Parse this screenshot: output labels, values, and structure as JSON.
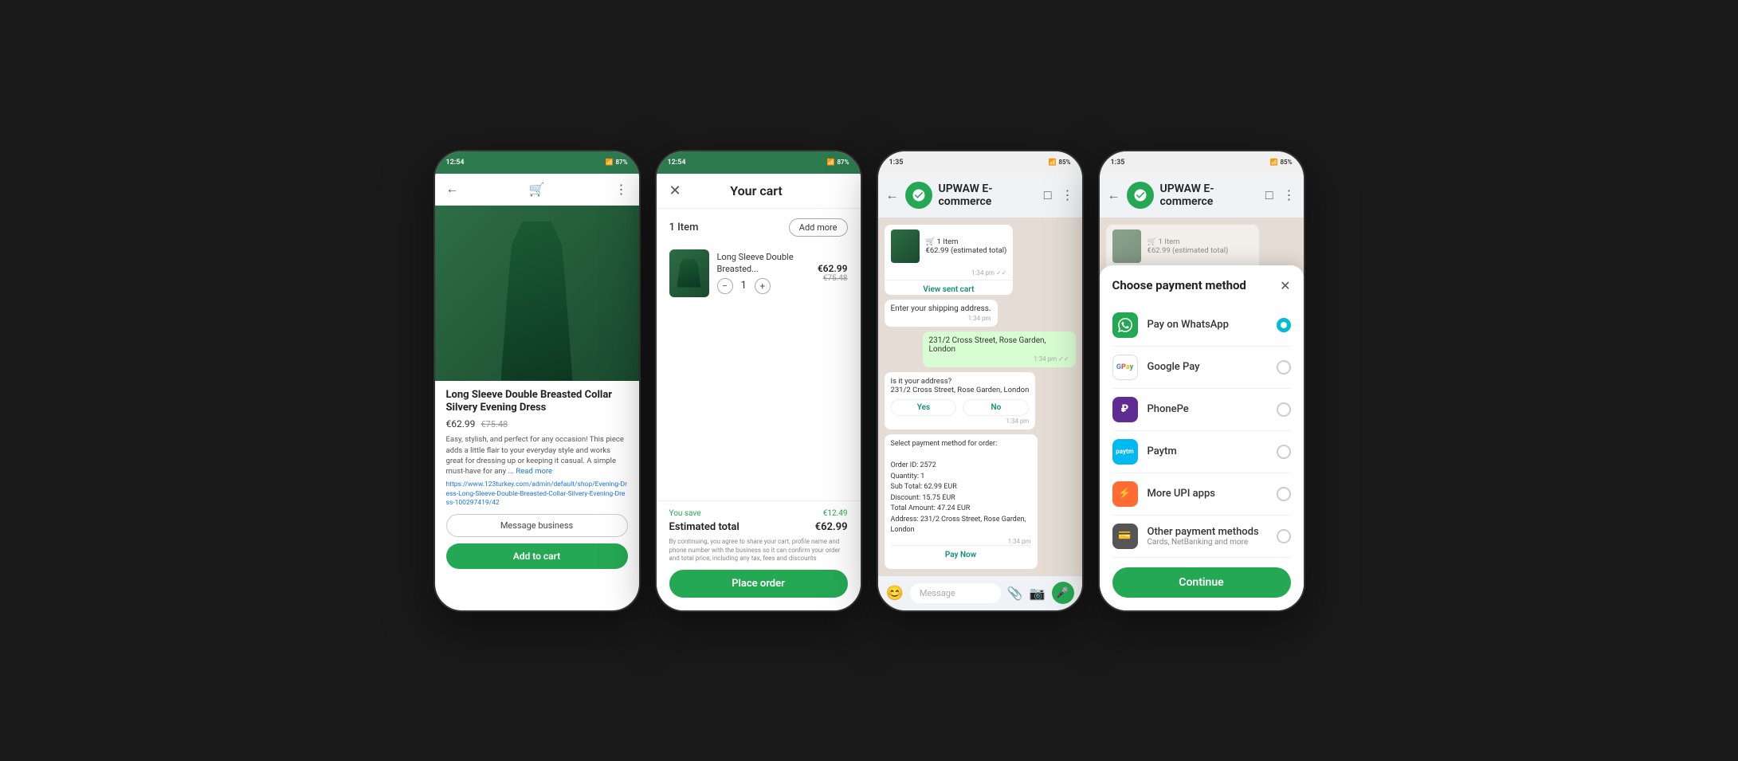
{
  "phone1": {
    "statusbar": {
      "time": "12:54",
      "battery": "87%"
    },
    "product": {
      "title": "Long Sleeve Double Breasted Collar Silvery Evening Dress",
      "price": "€62.99",
      "original_price": "€75.48",
      "description": "Easy, stylish, and perfect for any occasion! This piece adds a little flair to your everyday style and works great for dressing up or keeping it casual. A simple must-have for any ...",
      "read_more": "Read more",
      "link": "https://www.123turkey.com/admin/default/shop/Evening-Dress-Long-Sleeve-Double-Breasted-Collar-Silvery-Evening-Dress-100297419/42",
      "message_btn": "Message business",
      "add_to_cart_btn": "Add to cart"
    }
  },
  "phone2": {
    "statusbar": {
      "time": "12:54",
      "battery": "87%"
    },
    "cart": {
      "title": "Your cart",
      "items_count": "1 Item",
      "add_more_btn": "Add more",
      "item_name": "Long Sleeve Double Breasted...",
      "item_price": "€62.99",
      "item_original_price": "€75.48",
      "item_qty": "1",
      "you_save_label": "You save",
      "you_save_amount": "€12.49",
      "estimated_total_label": "Estimated total",
      "estimated_total_amount": "€62.99",
      "disclaimer": "By continuing, you agree to share your cart, profile name and phone number with the business so it can confirm your order and total price, including any tax, fees and discounts",
      "place_order_btn": "Place order"
    }
  },
  "phone3": {
    "statusbar": {
      "time": "1:35",
      "battery": "85%"
    },
    "chat": {
      "business_name": "UPWAW E-commerce",
      "order_card": {
        "items": "🛒 1 Item",
        "price": "€62.99 (estimated total)"
      },
      "view_cart": "View sent cart",
      "shipping_prompt": "Enter your shipping address.",
      "address": "231/2 Cross Street, Rose Garden, London",
      "confirm_prompt": "Is it your address?\n231/2 Cross Street, Rose Garden, London",
      "yes_btn": "Yes",
      "no_btn": "No",
      "business_confirm": "UPWAW E-commerce\nIs it your address?\n231/2 Cross Street, Rose Garden, London\nYes",
      "payment_prompt": "Select payment method for order:\n\nOrder ID: 2572\nQuantity: 1\nSub Total: 62.99 EUR\nDiscount: 15.75 EUR\nTotal Amount: 47.24 EUR\nAddress: 231/2 Cross Street, Rose Garden, London",
      "pay_now_btn": "Pay Now",
      "message_placeholder": "Message",
      "times": [
        "1:34 pm",
        "1:34 pm",
        "1:34 pm",
        "1:34 pm",
        "1:34 pm"
      ]
    }
  },
  "phone4": {
    "statusbar": {
      "time": "1:35",
      "battery": "85%"
    },
    "chat": {
      "business_name": "UPWAW E-commerce"
    },
    "payment_modal": {
      "title": "Choose payment method",
      "options": [
        {
          "id": "whatsapp",
          "label": "Pay on WhatsApp",
          "sublabel": "",
          "selected": true
        },
        {
          "id": "gpay",
          "label": "Google Pay",
          "sublabel": "",
          "selected": false
        },
        {
          "id": "phonepe",
          "label": "PhonePe",
          "sublabel": "",
          "selected": false
        },
        {
          "id": "paytm",
          "label": "Paytm",
          "sublabel": "",
          "selected": false
        },
        {
          "id": "upi",
          "label": "More UPI apps",
          "sublabel": "",
          "selected": false
        },
        {
          "id": "other",
          "label": "Other payment methods",
          "sublabel": "Cards, NetBanking and more",
          "selected": false
        }
      ],
      "continue_btn": "Continue"
    }
  }
}
